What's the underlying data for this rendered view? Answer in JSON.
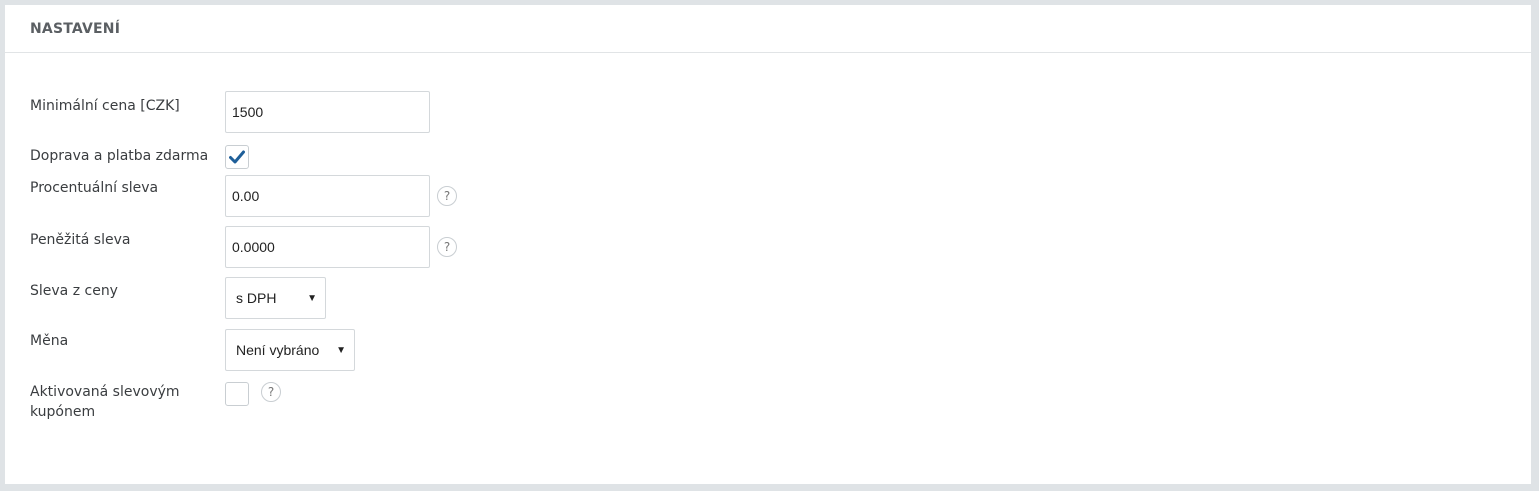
{
  "panel": {
    "title": "NASTAVENÍ"
  },
  "form": {
    "min_price": {
      "label": "Minimální cena [CZK]",
      "value": "1500"
    },
    "free_shipping": {
      "label": "Doprava a platba zdarma",
      "checked": true
    },
    "percent_discount": {
      "label": "Procentuální sleva",
      "value": "0.00",
      "help": "?"
    },
    "money_discount": {
      "label": "Peněžitá sleva",
      "value": "0.0000",
      "help": "?"
    },
    "discount_from_price": {
      "label": "Sleva z ceny",
      "selected": "s DPH",
      "caret": "▼"
    },
    "currency": {
      "label": "Měna",
      "selected": "Není vybráno",
      "caret": "▼"
    },
    "coupon_activated": {
      "label": "Aktivovaná slevovým kupónem",
      "checked": false,
      "help": "?"
    }
  },
  "colors": {
    "accent": "#1f5f99",
    "border": "#d4d8db",
    "page_bg": "#dfe3e6"
  }
}
